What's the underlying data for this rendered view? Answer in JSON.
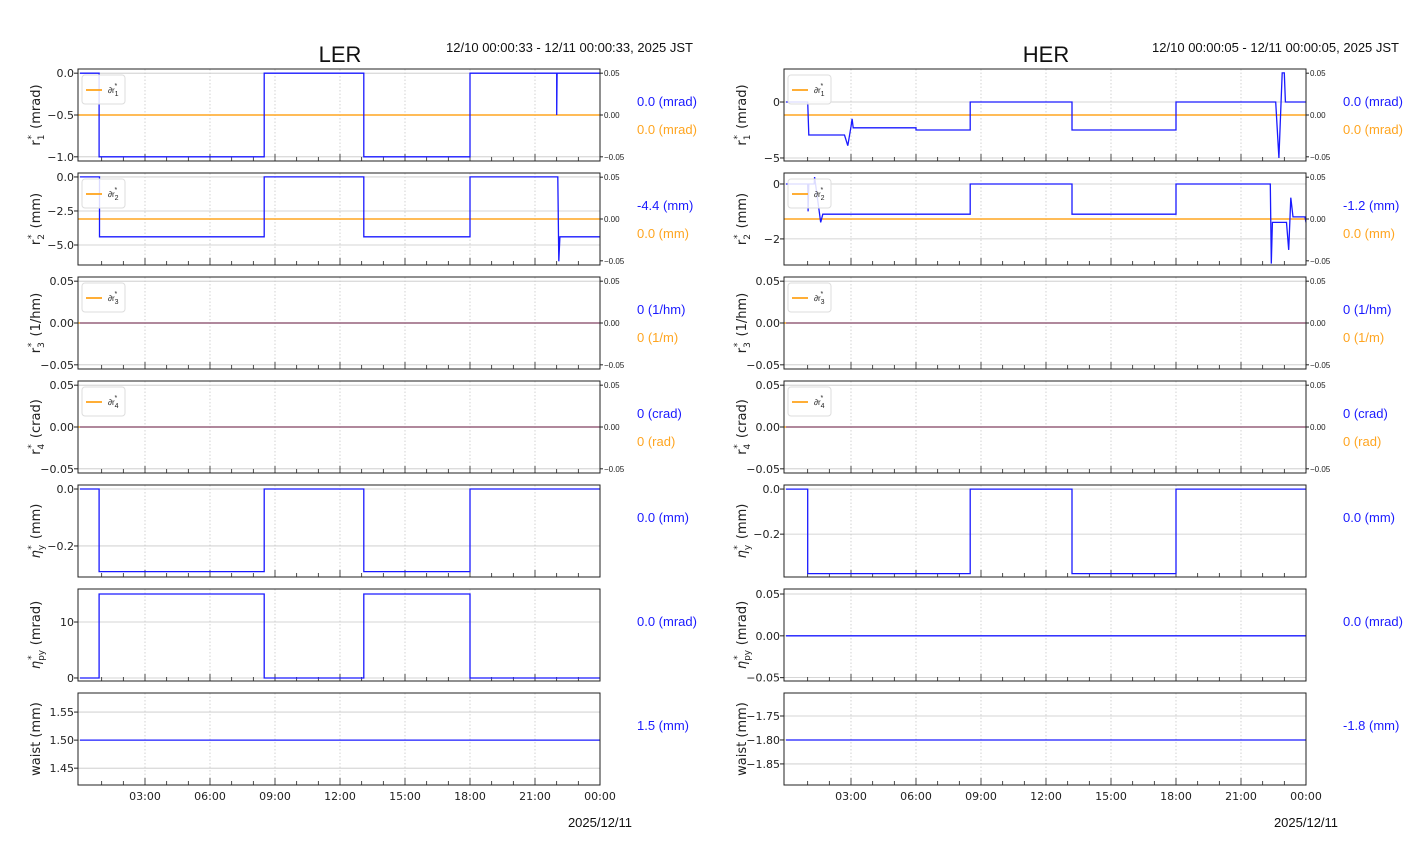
{
  "colors": {
    "series": "#1a1aff",
    "reference": "#ffa520",
    "grid": "#c8c8c8"
  },
  "chart_data": [
    {
      "type": "line",
      "title": "LER",
      "subtitle": "12/10 00:00:33 - 12/11 00:00:33, 2025 JST",
      "xlabel": "2025/12/11",
      "xlim": [
        0,
        24
      ],
      "xticks": [
        3,
        6,
        9,
        12,
        15,
        18,
        21,
        24
      ],
      "xtick_labels": [
        "03:00",
        "06:00",
        "09:00",
        "12:00",
        "15:00",
        "18:00",
        "21:00",
        "00:00"
      ],
      "panels": [
        {
          "ylabel": {
            "sym": "r",
            "sub": "1",
            "unit": "(mrad)"
          },
          "ylim": [
            -1.05,
            0.05
          ],
          "yticks": [
            0,
            -0.5,
            -1
          ],
          "ytick_labels": [
            "0.0",
            "−0.5",
            "−1.0"
          ],
          "right": {
            "ylim": [
              -0.055,
              0.055
            ],
            "yticks": [
              0.05,
              0,
              -0.05
            ],
            "ytick_labels": [
              "0.05",
              "0.00",
              "−0.05"
            ],
            "value": 0
          },
          "legend": {
            "sym": "∂r",
            "sub": "1"
          },
          "series": [
            [
              0,
              0
            ],
            [
              0.88,
              0
            ],
            [
              0.88,
              -1
            ],
            [
              8.5,
              -1
            ],
            [
              8.5,
              0
            ],
            [
              13.1,
              0
            ],
            [
              13.1,
              -1
            ],
            [
              18.0,
              -1
            ],
            [
              18.0,
              0
            ],
            [
              22.0,
              0
            ],
            [
              22.0,
              -0.5
            ],
            [
              22.02,
              0
            ],
            [
              24,
              0
            ]
          ],
          "value_label": "0.0 (mrad)",
          "ref_label": "0.0 (mrad)"
        },
        {
          "ylabel": {
            "sym": "r",
            "sub": "2",
            "unit": "(mm)"
          },
          "ylim": [
            -6.47,
            0.29
          ],
          "yticks": [
            0,
            -2.5,
            -5
          ],
          "ytick_labels": [
            "0.0",
            "−2.5",
            "−5.0"
          ],
          "right": {
            "ylim": [
              -0.055,
              0.055
            ],
            "yticks": [
              0.05,
              0,
              -0.05
            ],
            "ytick_labels": [
              "0.05",
              "0.00",
              "−0.05"
            ],
            "value": 0
          },
          "legend": {
            "sym": "∂r",
            "sub": "2"
          },
          "series": [
            [
              0,
              0
            ],
            [
              0.9,
              0
            ],
            [
              0.9,
              -4.4
            ],
            [
              8.5,
              -4.4
            ],
            [
              8.5,
              0
            ],
            [
              13.1,
              0
            ],
            [
              13.1,
              -4.4
            ],
            [
              18.0,
              -4.4
            ],
            [
              18.0,
              0
            ],
            [
              22.05,
              0
            ],
            [
              22.1,
              -6.2
            ],
            [
              22.15,
              -4.4
            ],
            [
              24,
              -4.4
            ]
          ],
          "value_label": "-4.4 (mm)",
          "ref_label": "0.0 (mm)"
        },
        {
          "ylabel": {
            "sym": "r",
            "sub": "3",
            "unit": "(1/hm)"
          },
          "ylim": [
            -0.055,
            0.055
          ],
          "yticks": [
            0.05,
            0,
            -0.05
          ],
          "ytick_labels": [
            "0.05",
            "0.00",
            "−0.05"
          ],
          "right": {
            "ylim": [
              -0.055,
              0.055
            ],
            "yticks": [
              0.05,
              0,
              -0.05
            ],
            "ytick_labels": [
              "0.05",
              "0.00",
              "−0.05"
            ],
            "value": 0
          },
          "legend": {
            "sym": "∂r",
            "sub": "3"
          },
          "series": [
            [
              0,
              0
            ],
            [
              24,
              0
            ]
          ],
          "value_label": "0 (1/hm)",
          "ref_label": "0 (1/m)"
        },
        {
          "ylabel": {
            "sym": "r",
            "sub": "4",
            "unit": "(crad)"
          },
          "ylim": [
            -0.055,
            0.055
          ],
          "yticks": [
            0.05,
            0,
            -0.05
          ],
          "ytick_labels": [
            "0.05",
            "0.00",
            "−0.05"
          ],
          "right": {
            "ylim": [
              -0.055,
              0.055
            ],
            "yticks": [
              0.05,
              0,
              -0.05
            ],
            "ytick_labels": [
              "0.05",
              "0.00",
              "−0.05"
            ],
            "value": 0
          },
          "legend": {
            "sym": "∂r",
            "sub": "4"
          },
          "series": [
            [
              0,
              0
            ],
            [
              24,
              0
            ]
          ],
          "value_label": "0 (crad)",
          "ref_label": "0 (rad)"
        },
        {
          "ylabel": {
            "sym": "η",
            "sub": "y",
            "unit": "(mm)"
          },
          "ylim": [
            -0.309,
            0.014
          ],
          "yticks": [
            0,
            -0.2
          ],
          "ytick_labels": [
            "0.0",
            "−0.2"
          ],
          "series": [
            [
              0,
              0
            ],
            [
              0.88,
              0
            ],
            [
              0.88,
              -0.29
            ],
            [
              8.5,
              -0.29
            ],
            [
              8.5,
              0
            ],
            [
              13.1,
              0
            ],
            [
              13.1,
              -0.29
            ],
            [
              18.0,
              -0.29
            ],
            [
              18.0,
              0
            ],
            [
              24,
              0
            ]
          ],
          "value_label": "0.0 (mm)"
        },
        {
          "ylabel": {
            "sym": "η",
            "sub": "py",
            "unit": "(mrad)"
          },
          "ylim": [
            -0.54,
            15.9
          ],
          "yticks": [
            10,
            0
          ],
          "ytick_labels": [
            "10",
            "0"
          ],
          "series": [
            [
              0,
              0
            ],
            [
              0.88,
              0
            ],
            [
              0.88,
              15
            ],
            [
              8.5,
              15
            ],
            [
              8.5,
              0
            ],
            [
              13.1,
              0
            ],
            [
              13.1,
              15
            ],
            [
              18.0,
              15
            ],
            [
              18.0,
              0
            ],
            [
              24,
              0
            ]
          ],
          "value_label": "0.0 (mrad)"
        },
        {
          "ylabel": {
            "plain": "waist (mm)"
          },
          "ylim": [
            1.42,
            1.584
          ],
          "yticks": [
            1.55,
            1.5,
            1.45
          ],
          "ytick_labels": [
            "1.55",
            "1.50",
            "1.45"
          ],
          "series": [
            [
              0,
              1.5
            ],
            [
              24,
              1.5
            ]
          ],
          "value_label": "1.5 (mm)"
        }
      ]
    },
    {
      "type": "line",
      "title": "HER",
      "subtitle": "12/10 00:00:05 - 12/11 00:00:05, 2025 JST",
      "xlabel": "2025/12/11",
      "xlim": [
        0,
        24
      ],
      "xticks": [
        3,
        6,
        9,
        12,
        15,
        18,
        21,
        24
      ],
      "xtick_labels": [
        "03:00",
        "06:00",
        "09:00",
        "12:00",
        "15:00",
        "18:00",
        "21:00",
        "00:00"
      ],
      "panels": [
        {
          "ylabel": {
            "sym": "r",
            "sub": "1",
            "unit": "(mrad)"
          },
          "ylim": [
            -5.27,
            2.95
          ],
          "yticks": [
            0,
            -5
          ],
          "ytick_labels": [
            "0",
            "−5"
          ],
          "right": {
            "ylim": [
              -0.055,
              0.055
            ],
            "yticks": [
              0.05,
              0,
              -0.05
            ],
            "ytick_labels": [
              "0.05",
              "0.00",
              "−0.05"
            ],
            "value": 0
          },
          "legend": {
            "sym": "∂r",
            "sub": "1"
          },
          "series": [
            [
              0,
              0
            ],
            [
              1.0,
              0
            ],
            [
              1.05,
              -2.95
            ],
            [
              2.7,
              -2.95
            ],
            [
              2.85,
              -3.9
            ],
            [
              3.0,
              -2.2
            ],
            [
              3.05,
              -1.5
            ],
            [
              3.1,
              -2.3
            ],
            [
              6.0,
              -2.3
            ],
            [
              6.0,
              -2.5
            ],
            [
              8.5,
              -2.5
            ],
            [
              8.5,
              0
            ],
            [
              13.2,
              0
            ],
            [
              13.2,
              -2.5
            ],
            [
              18.0,
              -2.5
            ],
            [
              18.0,
              0
            ],
            [
              22.6,
              0
            ],
            [
              22.75,
              -5
            ],
            [
              22.9,
              2.6
            ],
            [
              23.0,
              2.6
            ],
            [
              23.05,
              0
            ],
            [
              24,
              0
            ]
          ],
          "value_label": "0.0 (mrad)",
          "ref_label": "0.0 (mrad)"
        },
        {
          "ylabel": {
            "sym": "r",
            "sub": "2",
            "unit": "(mm)"
          },
          "ylim": [
            -2.95,
            0.4
          ],
          "yticks": [
            0,
            -2
          ],
          "ytick_labels": [
            "0",
            "−2"
          ],
          "right": {
            "ylim": [
              -0.055,
              0.055
            ],
            "yticks": [
              0.05,
              0,
              -0.05
            ],
            "ytick_labels": [
              "0.05",
              "0.00",
              "−0.05"
            ],
            "value": 0
          },
          "legend": {
            "sym": "∂r",
            "sub": "2"
          },
          "series": [
            [
              0,
              0
            ],
            [
              1.0,
              0
            ],
            [
              1.02,
              -1.0
            ],
            [
              1.05,
              0
            ],
            [
              1.3,
              0
            ],
            [
              1.32,
              0.25
            ],
            [
              1.6,
              -1.4
            ],
            [
              1.7,
              -1.1
            ],
            [
              8.5,
              -1.1
            ],
            [
              8.5,
              0
            ],
            [
              13.2,
              0
            ],
            [
              13.2,
              -1.1
            ],
            [
              18.0,
              -1.1
            ],
            [
              18.0,
              0
            ],
            [
              22.35,
              0
            ],
            [
              22.4,
              -2.9
            ],
            [
              22.45,
              -1.4
            ],
            [
              23.1,
              -1.4
            ],
            [
              23.2,
              -2.4
            ],
            [
              23.3,
              -0.5
            ],
            [
              23.4,
              -1.2
            ],
            [
              23.95,
              -1.2
            ],
            [
              24,
              -1.4
            ]
          ],
          "value_label": "-1.2 (mm)",
          "ref_label": "0.0 (mm)"
        },
        {
          "ylabel": {
            "sym": "r",
            "sub": "3",
            "unit": "(1/hm)"
          },
          "ylim": [
            -0.055,
            0.055
          ],
          "yticks": [
            0.05,
            0,
            -0.05
          ],
          "ytick_labels": [
            "0.05",
            "0.00",
            "−0.05"
          ],
          "right": {
            "ylim": [
              -0.055,
              0.055
            ],
            "yticks": [
              0.05,
              0,
              -0.05
            ],
            "ytick_labels": [
              "0.05",
              "0.00",
              "−0.05"
            ],
            "value": 0
          },
          "legend": {
            "sym": "∂r",
            "sub": "3"
          },
          "series": [
            [
              0,
              0
            ],
            [
              24,
              0
            ]
          ],
          "value_label": "0 (1/hm)",
          "ref_label": "0 (1/m)"
        },
        {
          "ylabel": {
            "sym": "r",
            "sub": "4",
            "unit": "(crad)"
          },
          "ylim": [
            -0.055,
            0.055
          ],
          "yticks": [
            0.05,
            0,
            -0.05
          ],
          "ytick_labels": [
            "0.05",
            "0.00",
            "−0.05"
          ],
          "right": {
            "ylim": [
              -0.055,
              0.055
            ],
            "yticks": [
              0.05,
              0,
              -0.05
            ],
            "ytick_labels": [
              "0.05",
              "0.00",
              "−0.05"
            ],
            "value": 0
          },
          "legend": {
            "sym": "∂r",
            "sub": "4"
          },
          "series": [
            [
              0,
              0
            ],
            [
              24,
              0
            ]
          ],
          "value_label": "0 (crad)",
          "ref_label": "0 (rad)"
        },
        {
          "ylabel": {
            "sym": "η",
            "sub": "y",
            "unit": "(mm)"
          },
          "ylim": [
            -0.39,
            0.018
          ],
          "yticks": [
            0,
            -0.2
          ],
          "ytick_labels": [
            "0.0",
            "−0.2"
          ],
          "series": [
            [
              0,
              0
            ],
            [
              1.0,
              0
            ],
            [
              1.0,
              -0.375
            ],
            [
              8.5,
              -0.375
            ],
            [
              8.5,
              0
            ],
            [
              13.2,
              0
            ],
            [
              13.2,
              -0.375
            ],
            [
              18.0,
              -0.375
            ],
            [
              18.0,
              0
            ],
            [
              24,
              0
            ]
          ],
          "value_label": "0.0 (mm)"
        },
        {
          "ylabel": {
            "sym": "η",
            "sub": "py",
            "unit": "(mrad)"
          },
          "ylim": [
            -0.054,
            0.056
          ],
          "yticks": [
            0.05,
            0,
            -0.05
          ],
          "ytick_labels": [
            "0.05",
            "0.00",
            "−0.05"
          ],
          "series": [
            [
              0,
              0
            ],
            [
              24,
              0
            ]
          ],
          "value_label": "0.0 (mrad)"
        },
        {
          "ylabel": {
            "plain": "waist (mm)"
          },
          "ylim": [
            -1.894,
            -1.702
          ],
          "yticks": [
            -1.75,
            -1.8,
            -1.85
          ],
          "ytick_labels": [
            "−1.75",
            "−1.80",
            "−1.85"
          ],
          "series": [
            [
              0,
              -1.8
            ],
            [
              24,
              -1.8
            ]
          ],
          "value_label": "-1.8 (mm)"
        }
      ]
    }
  ]
}
